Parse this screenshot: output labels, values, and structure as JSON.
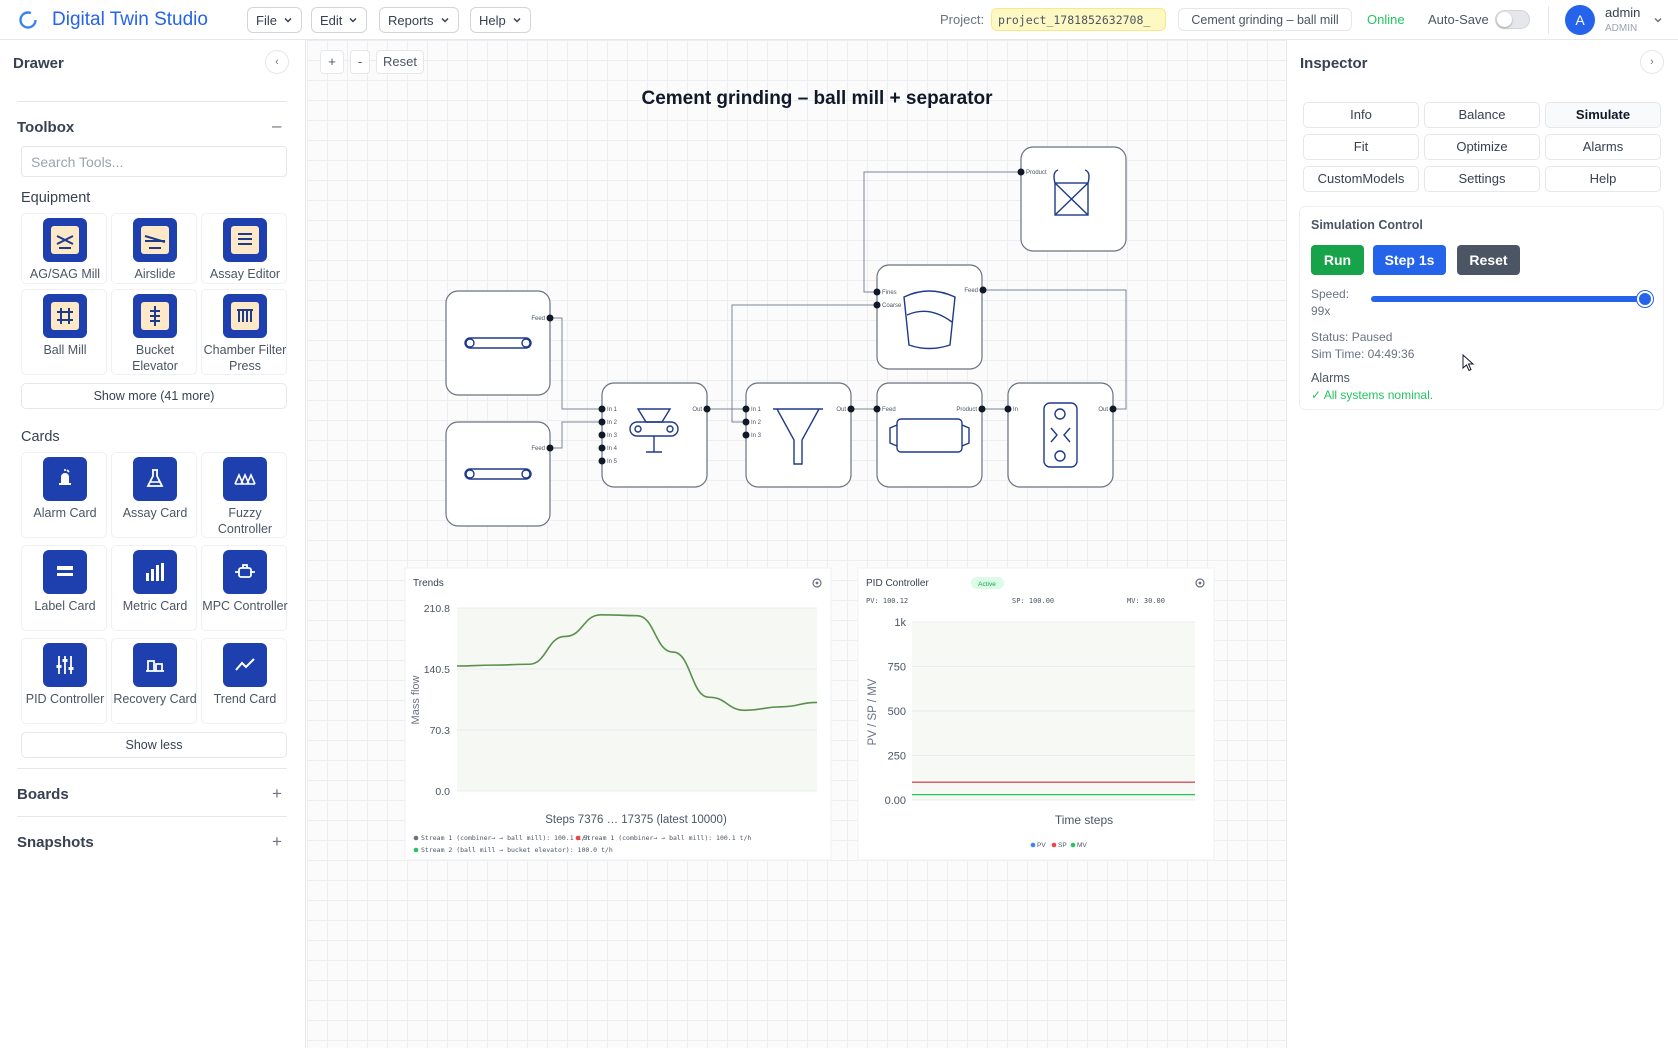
{
  "app": {
    "title": "Digital Twin Studio"
  },
  "menus": [
    "File",
    "Edit",
    "Reports",
    "Help"
  ],
  "project": {
    "label": "Project:",
    "id": "project_1781852632708_",
    "name": "Cement grinding – ball mill",
    "status": "Online",
    "autosave_label": "Auto-Save",
    "autosave_on": false
  },
  "user": {
    "initial": "A",
    "name": "admin",
    "role": "ADMIN"
  },
  "drawer": {
    "title": "Drawer",
    "toolbox": {
      "title": "Toolbox",
      "search_placeholder": "Search Tools..."
    },
    "equipment": {
      "title": "Equipment",
      "items": [
        "AG/SAG Mill",
        "Airslide",
        "Assay Editor",
        "Ball Mill",
        "Bucket Elevator",
        "Chamber Filter Press"
      ],
      "show_more": "Show more (41 more)"
    },
    "cards": {
      "title": "Cards",
      "items": [
        "Alarm Card",
        "Assay Card",
        "Fuzzy Controller",
        "Label Card",
        "Metric Card",
        "MPC Controller",
        "PID Controller",
        "Recovery Card",
        "Trend Card"
      ],
      "show_less": "Show less"
    },
    "boards": "Boards",
    "snapshots": "Snapshots"
  },
  "canvas": {
    "zoom_in": "+",
    "zoom_out": "-",
    "reset": "Reset",
    "flowsheet_title": "Cement grinding – ball mill + separator",
    "ports": {
      "feed": "Feed",
      "out": "Out",
      "product": "Product",
      "fines": "Fines",
      "coarse": "Coarse",
      "in1": "In 1",
      "in2": "In 2",
      "in3": "In 3",
      "in4": "In 4",
      "in5": "In 5",
      "in": "In"
    }
  },
  "trends": {
    "title": "Trends",
    "legend": [
      {
        "label": "Stream 1 (combiner→ → ball mill): 100.1 t/h",
        "color": "#6b7280"
      },
      {
        "label": "Stream 1 (combiner→ → ball mill): 100.1 t/h",
        "color": "#ef4444"
      },
      {
        "label": "Stream 2 (ball mill → bucket elevator): 100.0 t/h",
        "color": "#22c55e"
      }
    ]
  },
  "pid": {
    "title": "PID Controller",
    "badge": "Active",
    "pv": "PV: 100.12",
    "sp": "SP: 100.00",
    "mv": "MV: 30.00",
    "legend": [
      {
        "label": "PV",
        "color": "#3b82f6"
      },
      {
        "label": "SP",
        "color": "#ef4444"
      },
      {
        "label": "MV",
        "color": "#22c55e"
      }
    ]
  },
  "chart_data": [
    {
      "type": "line",
      "title": "Trends",
      "xlabel": "Steps 7376 … 17375 (latest 10000)",
      "ylabel": "Mass flow",
      "ylim": [
        0,
        210.8
      ],
      "yticks": [
        "210.8",
        "140.5",
        "70.3",
        "0.0"
      ],
      "x": [
        7376,
        8376,
        9376,
        10376,
        11376,
        12376,
        13376,
        14376,
        15376,
        16376,
        17375
      ],
      "series": [
        {
          "color": "#5a8f4e",
          "values": [
            144,
            145,
            146,
            178,
            203,
            202,
            160,
            108,
            93,
            97,
            102
          ]
        }
      ],
      "grid": true
    },
    {
      "type": "line",
      "title": "PID Controller",
      "xlabel": "Time steps",
      "ylabel": "PV / SP / MV",
      "ylim": [
        0,
        1000
      ],
      "yticks": [
        "1k",
        "750",
        "500",
        "250",
        "0.00"
      ],
      "series": [
        {
          "name": "PV",
          "color": "#3b82f6",
          "values": [
            100.12,
            100.12
          ]
        },
        {
          "name": "SP",
          "color": "#ef4444",
          "values": [
            100.0,
            100.0
          ]
        },
        {
          "name": "MV",
          "color": "#22c55e",
          "values": [
            30.0,
            30.0
          ]
        }
      ],
      "grid": true
    }
  ],
  "inspector": {
    "title": "Inspector",
    "tabs": [
      "Info",
      "Balance",
      "Simulate",
      "Fit",
      "Optimize",
      "Alarms",
      "CustomModels",
      "Settings",
      "Help"
    ],
    "active_tab": "Simulate",
    "sim": {
      "title": "Simulation Control",
      "run": "Run",
      "step": "Step 1s",
      "reset": "Reset",
      "speed_label": "Speed:",
      "speed_value": "99x",
      "speed_fraction": 0.97,
      "status": "Status: Paused",
      "sim_time": "Sim Time: 04:49:36",
      "alarms_title": "Alarms",
      "alarms_ok": "✓ All systems nominal."
    }
  },
  "colors": {
    "brand": "#2563eb",
    "run": "#16a34a",
    "step": "#2563eb",
    "reset": "#4b5563",
    "ok": "#22c55e",
    "node_icon": "#1e3a8a"
  }
}
